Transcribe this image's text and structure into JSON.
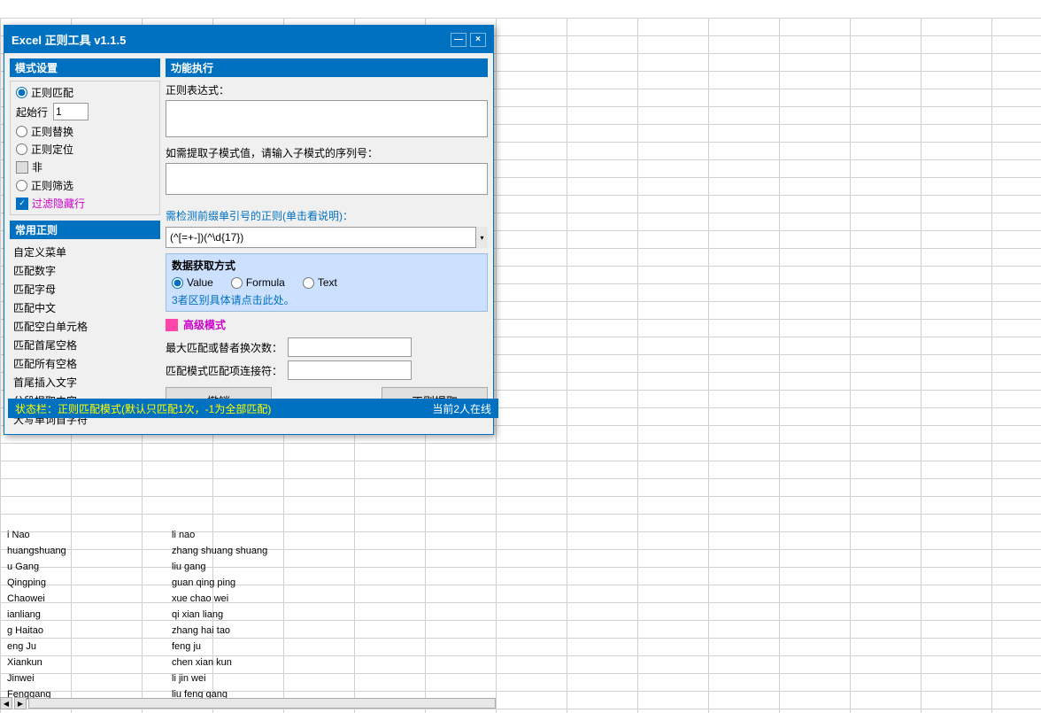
{
  "dialog": {
    "title": "Excel 正则工具 v1.1.5",
    "minimize_label": "—",
    "close_label": "×"
  },
  "left_panel": {
    "mode_section_title": "模式设置",
    "modes": [
      {
        "label": "正则匹配",
        "selected": true
      },
      {
        "label": "正则替换",
        "selected": false
      },
      {
        "label": "正则定位",
        "selected": false
      },
      {
        "label": "正则筛选",
        "selected": false
      }
    ],
    "start_row_label": "起始行",
    "start_row_value": "1",
    "non_label": "非",
    "filter_label": "过滤隐藏行",
    "common_rules_title": "常用正则",
    "rules": [
      "自定义菜单",
      "匹配数字",
      "匹配字母",
      "匹配中文",
      "匹配空白单元格",
      "匹配首尾空格",
      "匹配所有空格",
      "首尾插入文字",
      "分段提取内容",
      "大写单词首字符"
    ]
  },
  "right_panel": {
    "func_section_title": "功能执行",
    "regex_label": "正则表达式：",
    "regex_placeholder": "",
    "subpattern_label": "如需提取子模式值，请输入子模式的序列号：",
    "subpattern_placeholder": "",
    "detect_link": "需检测前缀单引号的正则(单击看说明)：",
    "detect_value": "(^[=+‐])(^\\d{17})",
    "data_fetch": {
      "title": "数据获取方式",
      "options": [
        {
          "label": "Value",
          "selected": true
        },
        {
          "label": "Formula",
          "selected": false
        },
        {
          "label": "Text",
          "selected": false
        }
      ],
      "diff_link": "3者区别具体请点击此处。"
    },
    "advanced": {
      "pink_square": true,
      "label": "高级模式",
      "max_match_label": "最大匹配或替者换次数：",
      "max_match_value": "",
      "connector_label": "匹配模式匹配项连接符：",
      "connector_value": ""
    },
    "cancel_label": "撤销",
    "execute_label": "正则提取"
  },
  "status_bar": {
    "text": "状态栏：正则匹配模式(默认只匹配1次，-1为全部匹配)",
    "online": "当前2人在线"
  },
  "spreadsheet": {
    "rows": [
      {
        "col1": "i Nao",
        "col2": "li nao"
      },
      {
        "col1": "huangshuang",
        "col2": "zhang shuang shuang"
      },
      {
        "col1": "u Gang",
        "col2": "liu gang"
      },
      {
        "col1": "Qingping",
        "col2": "guan qing ping"
      },
      {
        "col1": "Chaowei",
        "col2": "xue chao wei"
      },
      {
        "col1": "ianliang",
        "col2": "qi xian liang"
      },
      {
        "col1": "g Haitao",
        "col2": "zhang hai tao"
      },
      {
        "col1": "eng Ju",
        "col2": "feng ju"
      },
      {
        "col1": "Xiankun",
        "col2": "chen xian kun"
      },
      {
        "col1": "Jinwei",
        "col2": "li jin wei"
      },
      {
        "col1": "Fenggang",
        "col2": "liu feng gang"
      }
    ]
  }
}
